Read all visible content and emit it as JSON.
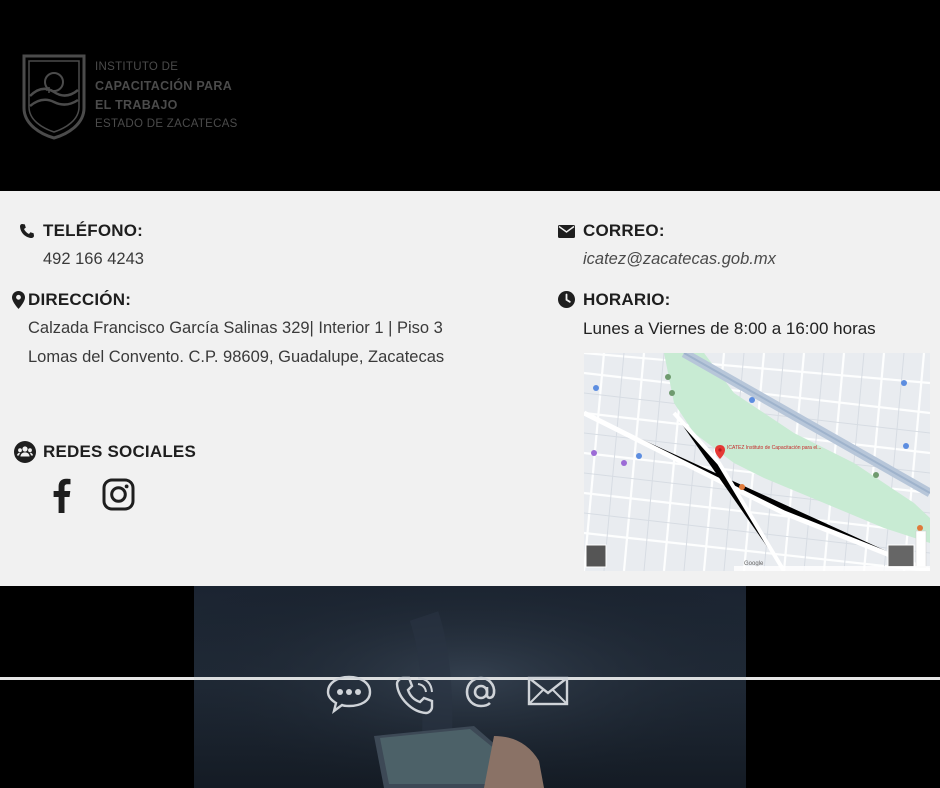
{
  "logo": {
    "line1": "INSTITUTO DE",
    "line2": "CAPACITACIÓN PARA",
    "line3": "EL TRABAJO",
    "line4": "ESTADO DE ZACATECAS"
  },
  "telefono": {
    "label": "TELÉFONO:",
    "value": "492 166 4243",
    "icon": "phone-icon"
  },
  "direccion": {
    "label": "DIRECCIÓN:",
    "line1": "Calzada Francisco García Salinas 329| Interior 1 | Piso 3",
    "line2": "Lomas del Convento. C.P. 98609, Guadalupe, Zacatecas",
    "icon": "map-pin-icon"
  },
  "correo": {
    "label": "CORREO:",
    "value": "icatez@zacatecas.gob.mx",
    "icon": "envelope-icon"
  },
  "horario": {
    "label": "HORARIO:",
    "value": "Lunes a Viernes de 8:00 a 16:00 horas",
    "icon": "clock-icon"
  },
  "redes": {
    "label": "REDES SOCIALES",
    "icon": "users-icon",
    "items": [
      "facebook-icon",
      "instagram-icon"
    ]
  },
  "map": {
    "place_label": "ICATEZ Instituto de Capacitación para el...",
    "google_label": "Google"
  },
  "bottom_icons": [
    "chat-bubble-icon",
    "phone-ringing-icon",
    "at-sign-icon",
    "mail-icon"
  ],
  "colors": {
    "panel_bg": "#f1f1f1",
    "header_bg": "#000000",
    "map_park": "#c8ebd3",
    "map_pin": "#e53935"
  }
}
